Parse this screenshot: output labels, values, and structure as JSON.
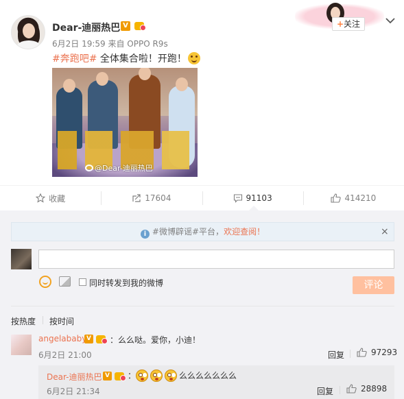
{
  "post": {
    "author": "Dear-迪丽热巴",
    "verified_badge": "V",
    "meta": "6月2日 19:59 来自 OPPO R9s",
    "hashtag": "#奔跑吧#",
    "text": " 全体集合啦！开跑！",
    "follow_label": "关注",
    "follow_plus": "+",
    "image_watermark": "@Dear-迪丽热巴"
  },
  "actions": [
    {
      "label": "收藏",
      "icon": "star-icon"
    },
    {
      "label": "17604",
      "icon": "repost-icon"
    },
    {
      "label": "91103",
      "icon": "comment-icon"
    },
    {
      "label": "414210",
      "icon": "thumbs-up-icon"
    }
  ],
  "notice": {
    "tag": "#微博辟谣#",
    "middle": "平台，",
    "highlight": "欢迎查阅！",
    "close": "×"
  },
  "composer": {
    "reply_value": "",
    "repost_checkbox_label": "同时转发到我的微博",
    "submit_label": "评论"
  },
  "sort": {
    "by_hot": "按热度",
    "by_time": "按时间"
  },
  "comments": [
    {
      "user": "angelababy",
      "badge": "V",
      "text": "：么么哒。爱你，小迪！",
      "time": "6月2日 21:00",
      "reply_label": "回复",
      "likes": "97293"
    },
    {
      "user": "Dear-迪丽热巴",
      "badge": "V",
      "text_prefix": "：",
      "text": "么么么么么么么",
      "time": "6月2日 21:34",
      "reply_label": "回复",
      "likes": "28898"
    }
  ],
  "colors": {
    "accent": "#eb7350",
    "panel_bg": "#f2f2f5",
    "submit_disabled": "#ffc09f",
    "verified_orange": "#f09a00"
  }
}
